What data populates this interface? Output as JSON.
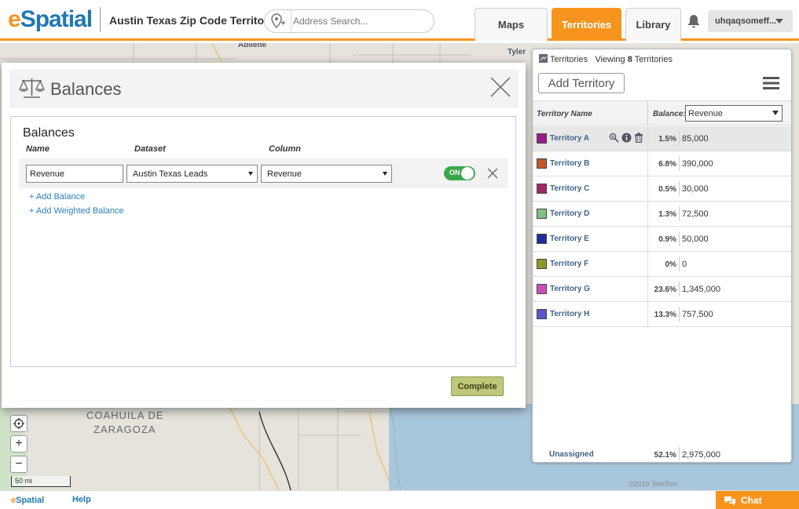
{
  "header": {
    "logo_e": "e",
    "logo_rest": "Spatial",
    "project_title": "Austin Texas Zip Code Territories",
    "search_placeholder": "Address Search...",
    "tabs": [
      {
        "label": "Maps",
        "active": false
      },
      {
        "label": "Territories",
        "active": true
      },
      {
        "label": "Library",
        "active": false
      }
    ],
    "user_name": "uhqaqsomeff..."
  },
  "map": {
    "labels": {
      "abilene": "Abilene",
      "tyler": "Tyler",
      "coahuila_1": "COAHUILA DE",
      "coahuila_2": "ZARAGOZA"
    },
    "scale": "50 mi",
    "credit": "©2019 TomTom",
    "controls": {
      "zoom_in": "+",
      "zoom_out": "−"
    }
  },
  "territories_panel": {
    "tab_label": "Territories",
    "viewing_prefix": "Viewing",
    "viewing_count": "8",
    "viewing_suffix": "Territories",
    "add_button": "Add Territory",
    "col_name": "Territory Name",
    "col_balance": "Balance:",
    "balance_selected": "Revenue",
    "rows": [
      {
        "name": "Territory A",
        "pct": "1.5%",
        "value": "85,000",
        "color": "#9b1a8a"
      },
      {
        "name": "Territory B",
        "pct": "6.8%",
        "value": "390,000",
        "color": "#c0562f"
      },
      {
        "name": "Territory C",
        "pct": "0.5%",
        "value": "30,000",
        "color": "#a02a5f"
      },
      {
        "name": "Territory D",
        "pct": "1.3%",
        "value": "72,500",
        "color": "#7fbf7f"
      },
      {
        "name": "Territory E",
        "pct": "0.9%",
        "value": "50,000",
        "color": "#1c2fa0"
      },
      {
        "name": "Territory F",
        "pct": "0%",
        "value": "0",
        "color": "#8d9a2a"
      },
      {
        "name": "Territory G",
        "pct": "23.6%",
        "value": "1,345,000",
        "color": "#c84fb5"
      },
      {
        "name": "Territory H",
        "pct": "13.3%",
        "value": "757,500",
        "color": "#5a55c8"
      }
    ],
    "unassigned": {
      "name": "Unassigned",
      "pct": "52.1%",
      "value": "2,975,000"
    }
  },
  "modal": {
    "title": "Balances",
    "section_title": "Balances",
    "col_name": "Name",
    "col_dataset": "Dataset",
    "col_column": "Column",
    "row": {
      "name_value": "Revenue",
      "dataset": "Austin Texas Leads",
      "column": "Revenue",
      "toggle_label": "ON"
    },
    "add_balance": "+ Add Balance",
    "add_weighted": "+ Add Weighted Balance",
    "complete": "Complete"
  },
  "footer": {
    "logo_e": "e",
    "logo_rest": "Spatial",
    "help": "Help",
    "chat": "Chat"
  },
  "colors": {
    "brand_orange": "#f7941e",
    "brand_blue": "#1f78b4",
    "toggle_on": "#3aa64a",
    "complete_btn": "#bfc77a"
  }
}
